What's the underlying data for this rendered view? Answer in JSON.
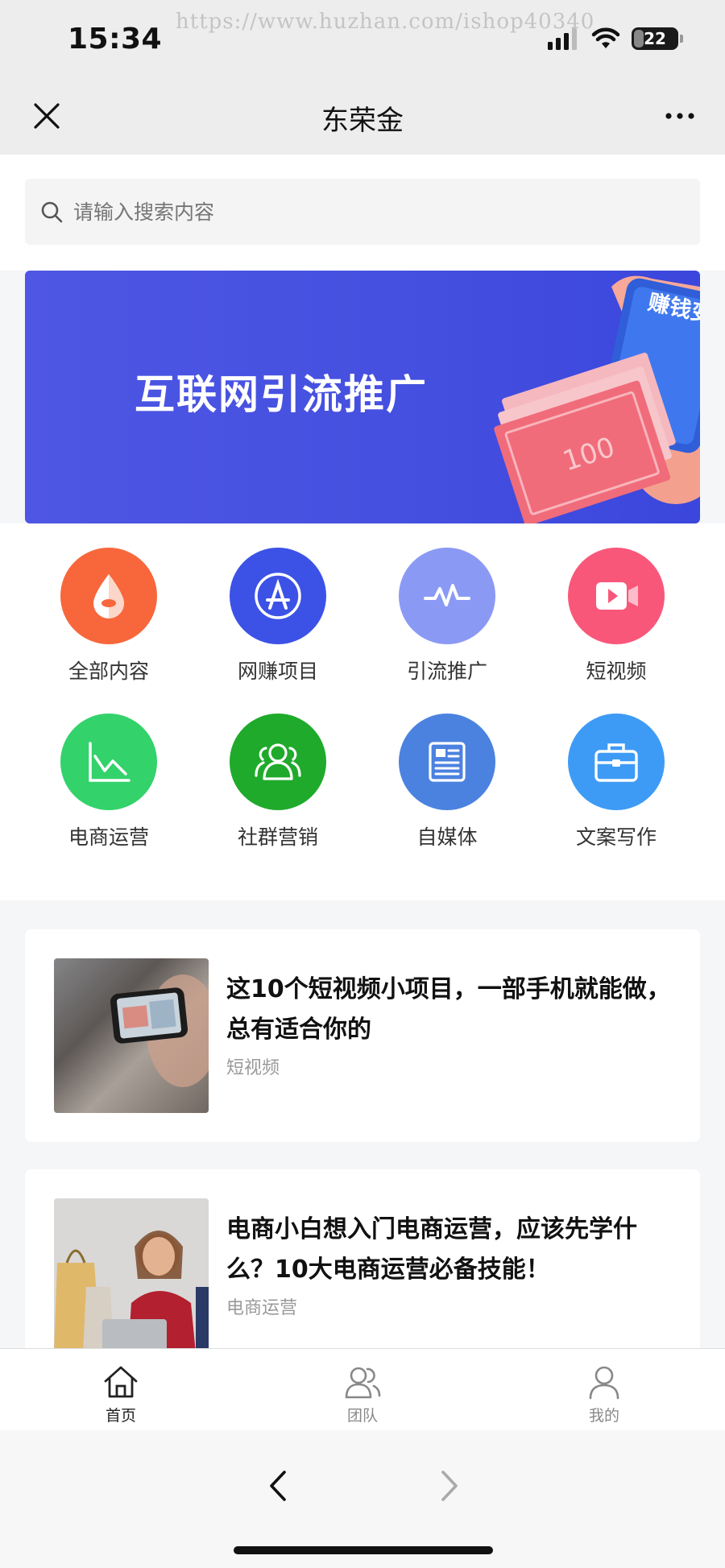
{
  "status": {
    "time": "15:34",
    "battery": "22",
    "watermark": "https://www.huzhan.com/ishop40340"
  },
  "nav": {
    "title": "东荣金"
  },
  "search": {
    "placeholder": "请输入搜索内容"
  },
  "banner": {
    "text": "互联网引流推广",
    "badge": "赚钱变简单",
    "bill_value": "100"
  },
  "categories": [
    {
      "label": "全部内容",
      "color": "#f7673b",
      "icon": "drop-icon"
    },
    {
      "label": "网赚项目",
      "color": "#3c52e6",
      "icon": "app-store-icon"
    },
    {
      "label": "引流推广",
      "color": "#8a9af4",
      "icon": "pulse-icon"
    },
    {
      "label": "短视频",
      "color": "#f9577a",
      "icon": "video-icon"
    },
    {
      "label": "电商运营",
      "color": "#33d26b",
      "icon": "line-chart-icon"
    },
    {
      "label": "社群营销",
      "color": "#1faa2b",
      "icon": "group-icon"
    },
    {
      "label": "自媒体",
      "color": "#4b82e0",
      "icon": "news-icon"
    },
    {
      "label": "文案写作",
      "color": "#3e9bf5",
      "icon": "briefcase-icon"
    }
  ],
  "articles": [
    {
      "title": "这10个短视频小项目，一部手机就能做，总有适合你的",
      "tag": "短视频"
    },
    {
      "title": "电商小白想入门电商运营，应该先学什么？10大电商运营必备技能！",
      "tag": "电商运营"
    }
  ],
  "tabs": [
    {
      "label": "首页",
      "icon": "home-icon",
      "active": true
    },
    {
      "label": "团队",
      "icon": "team-icon",
      "active": false
    },
    {
      "label": "我的",
      "icon": "user-icon",
      "active": false
    }
  ]
}
